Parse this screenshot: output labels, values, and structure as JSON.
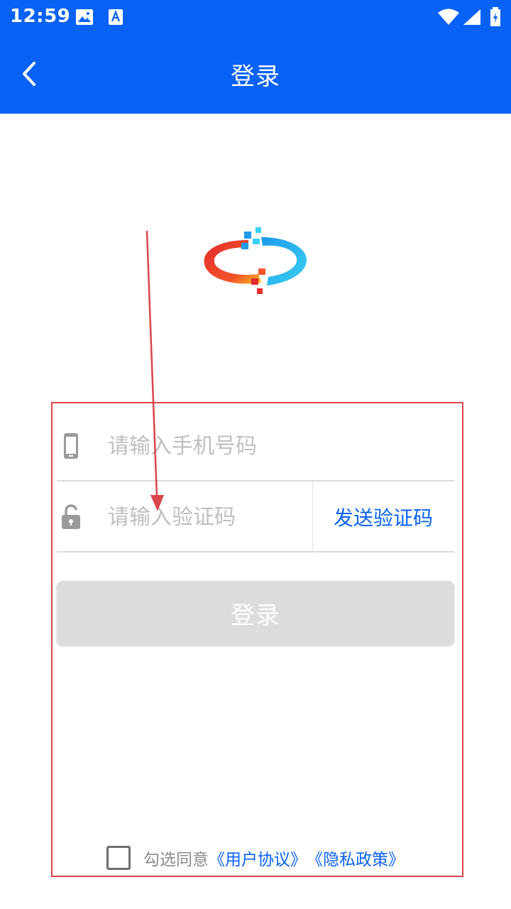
{
  "status_bar": {
    "time": "12:59",
    "icons": [
      "image-icon",
      "font-a-icon",
      "wifi-icon",
      "signal-icon",
      "battery-charging-icon"
    ]
  },
  "header": {
    "title": "登录",
    "back_icon": "chevron-left-icon"
  },
  "form": {
    "phone": {
      "placeholder": "请输入手机号码",
      "value": "",
      "icon": "phone-icon"
    },
    "code": {
      "placeholder": "请输入验证码",
      "value": "",
      "icon": "unlocked-padlock-icon"
    },
    "send_code_label": "发送验证码",
    "login_label": "登录"
  },
  "agreement": {
    "prefix": "勾选同意",
    "user_agreement": "《用户协议》",
    "privacy_policy": "《隐私政策》",
    "checked": false
  },
  "colors": {
    "brand_blue": "#0962F6",
    "annotation_red": "#D9464B",
    "disabled_button": "#DCDCDC"
  }
}
